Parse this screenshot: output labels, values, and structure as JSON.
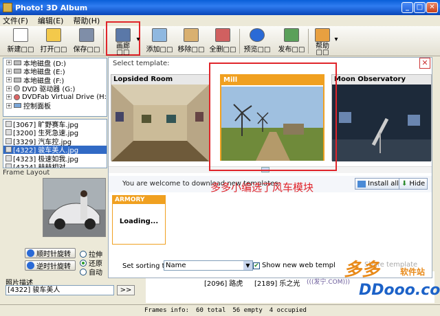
{
  "window": {
    "title": "Photo! 3D Album",
    "buttons": [
      "_",
      "□",
      "✕"
    ]
  },
  "menu": [
    "文件(F)",
    "编辑(E)",
    "帮助(H)"
  ],
  "toolbar": {
    "new": "新建□□",
    "open": "打开□□",
    "save": "保存□□",
    "gallery": "画廊□□",
    "add": "添加□□",
    "remove": "移除□□",
    "clear_all": "全删□□",
    "preview": "预览□□",
    "publish": "发布□□",
    "help": "帮助□□"
  },
  "tree": [
    {
      "label": "本地磁盘 (D:)"
    },
    {
      "label": "本地磁盘 (E:)"
    },
    {
      "label": "本地磁盘 (F:)"
    },
    {
      "label": "DVD 驱动器 (G:)"
    },
    {
      "label": "DVDFab Virtual Drive (H:"
    },
    {
      "label": "控制面板"
    }
  ],
  "files": [
    {
      "label": "[3067] 旷野赛车.jpg",
      "selected": false
    },
    {
      "label": "[3200] 生死急速.jpg",
      "selected": false
    },
    {
      "label": "[3329] 汽车控.jpg",
      "selected": false
    },
    {
      "label": "[4322] 骏车美人.jpg",
      "selected": true
    },
    {
      "label": "[4323] 极速如我.jpg",
      "selected": false
    },
    {
      "label": "[4324] 赫赫相对",
      "selected": false
    }
  ],
  "frame_layout": "Frame Layout",
  "rotate": {
    "ccw": "顺时针旋转",
    "cw": "逆时针旋转"
  },
  "fit_options": [
    {
      "label": "拉伸",
      "checked": false
    },
    {
      "label": "还原",
      "checked": true
    },
    {
      "label": "自动",
      "checked": false
    }
  ],
  "photo_desc": {
    "label": "照片描述",
    "value": "[4322] 骏车美人",
    "button": ">>"
  },
  "dialog": {
    "header": "Select template:",
    "close": "✕",
    "templates": [
      {
        "name": "Lopsided Room",
        "selected": false
      },
      {
        "name": "Mill",
        "selected": true
      },
      {
        "name": "Moon Observatory",
        "selected": false
      }
    ],
    "download_text": "You are welcome to download new templates:",
    "install_all": "Install all",
    "hide": "Hide",
    "armory": {
      "name": "ARMORY",
      "status": "Loading..."
    },
    "sort_label": "Set sorting type:",
    "sort_value": "Name",
    "show_web": "Show new web templ",
    "share": "Share template"
  },
  "annotation": "多多小编选了风车模块",
  "bottom_items": [
    "[2096] 路虎",
    "[2189] 乐之光"
  ],
  "status": {
    "frames_info": "Frames info:",
    "total": "60 total",
    "empty": "56 empty",
    "occupied": "4 occupied"
  },
  "watermark": {
    "brand": "多多",
    "sub": "软件站",
    "domain": "DDooo.com",
    "small": "(((发宁.COM)))"
  },
  "colors": {
    "accent": "#e0242a",
    "selected": "#316ac5",
    "template_orange": "#f0a020",
    "brand_blue": "#1c62c8",
    "brand_orange": "#e88a1a"
  }
}
